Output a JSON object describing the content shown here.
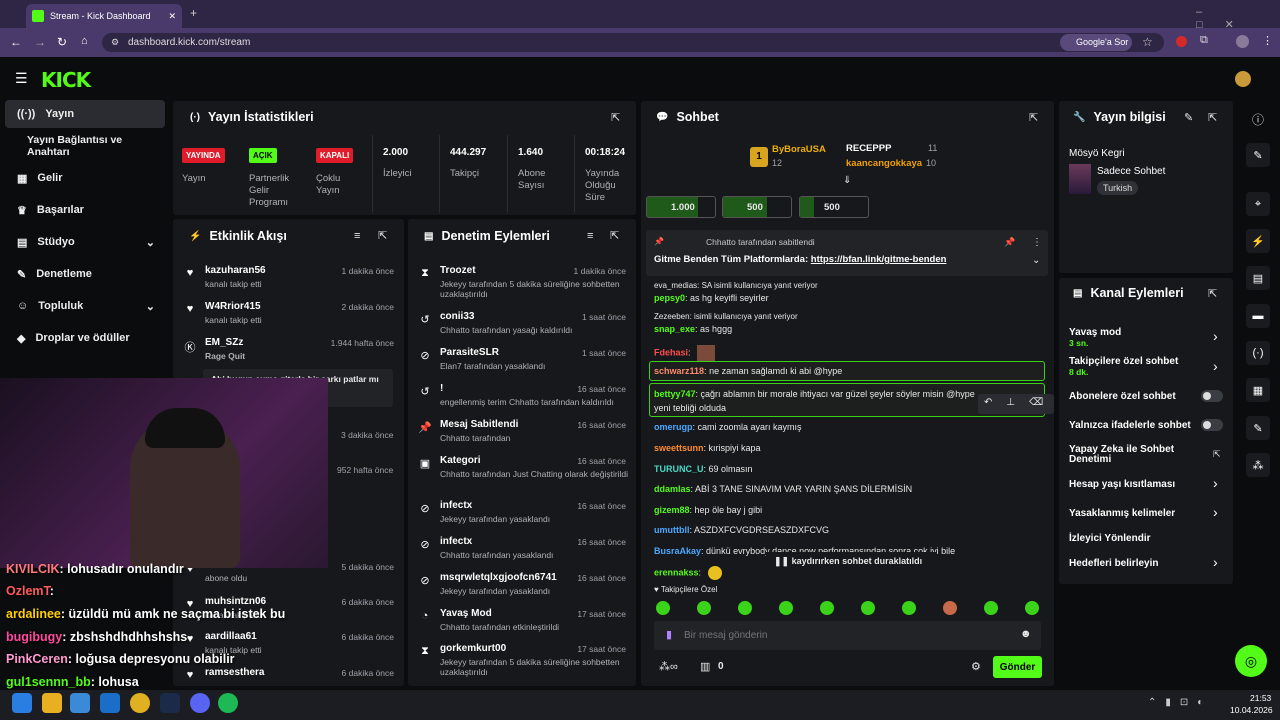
{
  "browser": {
    "tab_title": "Stream - Kick Dashboard",
    "url": "dashboard.kick.com/stream",
    "google_btn": "Google'a Sor"
  },
  "sidebar": {
    "items": [
      {
        "label": "Yayın"
      },
      {
        "label": "Yayın Bağlantısı ve Anahtarı"
      },
      {
        "label": "Gelir"
      },
      {
        "label": "Başarılar"
      },
      {
        "label": "Stüdyo"
      },
      {
        "label": "Denetleme"
      },
      {
        "label": "Topluluk"
      },
      {
        "label": "Droplar ve ödüller"
      }
    ]
  },
  "stats": {
    "title": "Yayın İstatistikleri",
    "badges": {
      "live": "YAYINDA",
      "open": "AÇIK",
      "closed": "KAPALI"
    },
    "labels": {
      "live": "Yayın",
      "partner": "Partnerlik Gelir Programı",
      "multi": "Çoklu Yayın",
      "viewers": "İzleyici",
      "followers": "Takipçi",
      "subs": "Abone Sayısı",
      "uptime": "Yayında Olduğu Süre"
    },
    "values": {
      "viewers": "2.000",
      "followers": "444.297",
      "subs": "1.640",
      "uptime": "00:18:24"
    }
  },
  "activity": {
    "title": "Etkinlik Akışı",
    "rows": [
      {
        "name": "kazuharan56",
        "sub": "kanalı takip etti",
        "time": "1 dakika önce"
      },
      {
        "name": "W4Rrior415",
        "sub": "kanalı takip etti",
        "time": "2 dakika önce"
      },
      {
        "name": "EM_SZz",
        "sub": "Rage Quit",
        "time": "1.944 hafta önce"
      },
      {
        "name": "Abi bugun cuma gitarla bir şarkı patlar mı",
        "time3": "3 dakika önce",
        "time4": "952 hafta önce"
      },
      {
        "name": "abone oldu",
        "time": "5 dakika önce"
      },
      {
        "name": "muhsintzn06",
        "sub": "kanalı takip etti",
        "time": "6 dakika önce"
      },
      {
        "name": "aardillaa61",
        "sub": "kanalı takip etti",
        "time": "6 dakika önce"
      },
      {
        "name": "ramsesthera",
        "time": "6 dakika önce"
      }
    ]
  },
  "moderation": {
    "title": "Denetim Eylemleri",
    "rows": [
      {
        "name": "Troozet",
        "sub": "Jekeyy tarafından 5 dakika süreliğine sohbetten uzaklaştırıldı",
        "time": "1 dakika önce"
      },
      {
        "name": "conii33",
        "sub": "Chhatto tarafından yasağı kaldırıldı",
        "time": "1 saat önce"
      },
      {
        "name": "ParasiteSLR",
        "sub": "Elan7 tarafından yasaklandı",
        "time": "1 saat önce"
      },
      {
        "name": "!",
        "sub": "engellenmiş terim Chhatto tarafından kaldırıldı",
        "time": "16 saat önce"
      },
      {
        "name": "Mesaj Sabitlendi",
        "sub": "Chhatto tarafından",
        "time": "16 saat önce"
      },
      {
        "name": "Kategori",
        "sub": "Chhatto tarafından Just Chatting olarak değiştirildi",
        "time": "16 saat önce"
      },
      {
        "name": "infectx",
        "sub": "Jekeyy tarafından yasaklandı",
        "time": "16 saat önce"
      },
      {
        "name": "infectx",
        "sub": "Chhatto tarafından yasaklandı",
        "time": "16 saat önce"
      },
      {
        "name": "msqrwletqlxgjoofcn6741",
        "sub": "Jekeyy tarafından yasaklandı",
        "time": "16 saat önce"
      },
      {
        "name": "Yavaş Mod",
        "sub": "Chhatto tarafından etkinleştirildi",
        "time": "17 saat önce"
      },
      {
        "name": "gorkemkurt00",
        "sub": "Jekeyy tarafından 5 dakika süreliğine sohbetten uzaklaştırıldı",
        "time": "17 saat önce"
      }
    ]
  },
  "chat": {
    "title": "Sohbet",
    "leaders": [
      {
        "name": "ByBoraUSA",
        "val": "12"
      },
      {
        "name": "RECEPPP",
        "val": "11"
      },
      {
        "name": "kaancangokkaya",
        "val": "10"
      }
    ],
    "goals": [
      "1.000",
      "500",
      "500"
    ],
    "pinned": {
      "by": "Chhatto tarafından sabitlendi",
      "text": "Gitme Benden Tüm Platformlarda: ",
      "link": "https://bfan.link/gitme-benden"
    },
    "messages": [
      {
        "u": "eva_medias",
        "m": "SA isimli kullanıcıya yanıt veriyor"
      },
      {
        "u": "pepsy0",
        "m": "as hg keyifli seyirler"
      },
      {
        "u": "Zezeeben",
        "m": "isimli kullanıcıya yanıt veriyor"
      },
      {
        "u": "snap_exe",
        "m": "as hggg"
      },
      {
        "u": "Fdehasi",
        "m": ""
      },
      {
        "u": "schwarz118",
        "m": "ne zaman sağlamdı ki abi @hype"
      },
      {
        "u": "bettyy747",
        "m": "çağrı ablamın bir morale ihtiyacı var güzel şeyler söyler misin @hype yeni tebliği olduda"
      },
      {
        "u": "omerugp",
        "m": "cami zoomla ayarı kaymış"
      },
      {
        "u": "sweettsunn",
        "m": "kırispiyi kapa"
      },
      {
        "u": "TURUNC_U",
        "m": "69 olmasın"
      },
      {
        "u": "ddamlas",
        "m": "ABİ 3 TANE SINAVIM VAR YARIN ŞANS DİLERMİSİN"
      },
      {
        "u": "gizem88",
        "m": "hep öle bay j gibi"
      },
      {
        "u": "umuttbll",
        "m": "ASZDXFCVGDRSEASZDXFCVG"
      },
      {
        "u": "BusraAkay",
        "m": "dünkü evrybody dance now performansından sonra çok iyi bile"
      },
      {
        "u": "erennakss",
        "m": ""
      }
    ],
    "paused": "kaydırırken sohbet duraklatıldı",
    "followers_only": "Takipçilere Özel",
    "placeholder": "Bir mesaj gönderin",
    "points": "0",
    "send": "Gönder"
  },
  "streaminfo": {
    "title": "Yayın bilgisi",
    "name": "Mösyö Kegri",
    "cat": "Sadece Sohbet",
    "tag": "Turkish"
  },
  "channel": {
    "title": "Kanal Eylemleri",
    "items": [
      {
        "label": "Yavaş mod",
        "sub": "3 sn."
      },
      {
        "label": "Takipçilere özel sohbet",
        "sub": "8 dk."
      },
      {
        "label": "Abonelere özel sohbet"
      },
      {
        "label": "Yalnızca ifadelerle sohbet"
      },
      {
        "label": "Yapay Zeka ile Sohbet Denetimi"
      },
      {
        "label": "Hesap yaşı kısıtlaması"
      },
      {
        "label": "Yasaklanmış kelimeler"
      },
      {
        "label": "İzleyici Yönlendir"
      },
      {
        "label": "Hedefleri belirleyin"
      }
    ]
  },
  "overlay": {
    "lines": [
      {
        "u": "KIVILCIK",
        "m": ": lohusadır onulandır"
      },
      {
        "u": "OzlemT",
        "m": ":"
      },
      {
        "u": "ardalinee",
        "m": ": üzüldü mü amk ne saçma bi istek bu"
      },
      {
        "u": "bugibugy",
        "m": ": zbshshdhdhhshshs"
      },
      {
        "u": "PinkCeren",
        "m": ": loğusa depresyonu olabilir"
      },
      {
        "u": "gul1sennn_bb",
        "m": ": lohusa"
      }
    ]
  },
  "taskbar": {
    "time": "21:53",
    "date": "10.04.2026"
  },
  "colors": {
    "kick_green": "#53fc18",
    "panel": "#17181b",
    "bg": "#0b0c0e",
    "browser": "#4a3a6b"
  }
}
